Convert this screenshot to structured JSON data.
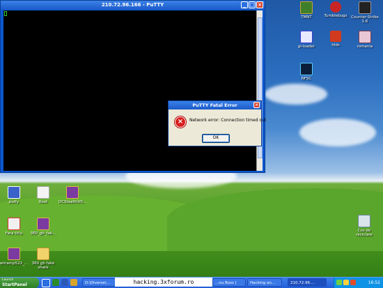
{
  "putty": {
    "title": "210.72.96.166 - PuTTY"
  },
  "dialog": {
    "title": "PuTTY Fatal Error",
    "message": "Network error: Connection timed out",
    "ok_label": "OK"
  },
  "desktop_icons": [
    {
      "label": "TMNT"
    },
    {
      "label": "Tumblebugs"
    },
    {
      "label": "Counter-Strike 1.6"
    },
    {
      "label": "gl-loader"
    },
    {
      "label": "hlds"
    },
    {
      "label": "romania"
    },
    {
      "label": "NFSC"
    },
    {
      "label": "putty"
    },
    {
      "label": "Root"
    },
    {
      "label": "DCStealthV0..."
    },
    {
      "label": "Fara titlu"
    },
    {
      "label": "360_gb_fak..."
    },
    {
      "label": "winamp522_..."
    },
    {
      "label": "360 gb fake share"
    },
    {
      "label": "Cos de reciclare"
    }
  ],
  "taskbar": {
    "start_label_1": "Launch",
    "start_label_2": "StartPanel",
    "tasks": [
      "D:\\Diverse\\...",
      "...nu Boss (",
      "Hacking an...",
      "210.72.96...."
    ],
    "clock": "16:52"
  },
  "watermark": "hacking.3xforum.ro",
  "colors": {
    "titlebar": "#1c5bc9",
    "error_red": "#d81e1e",
    "taskbar": "#245edb",
    "start_green": "#2e7e25"
  }
}
